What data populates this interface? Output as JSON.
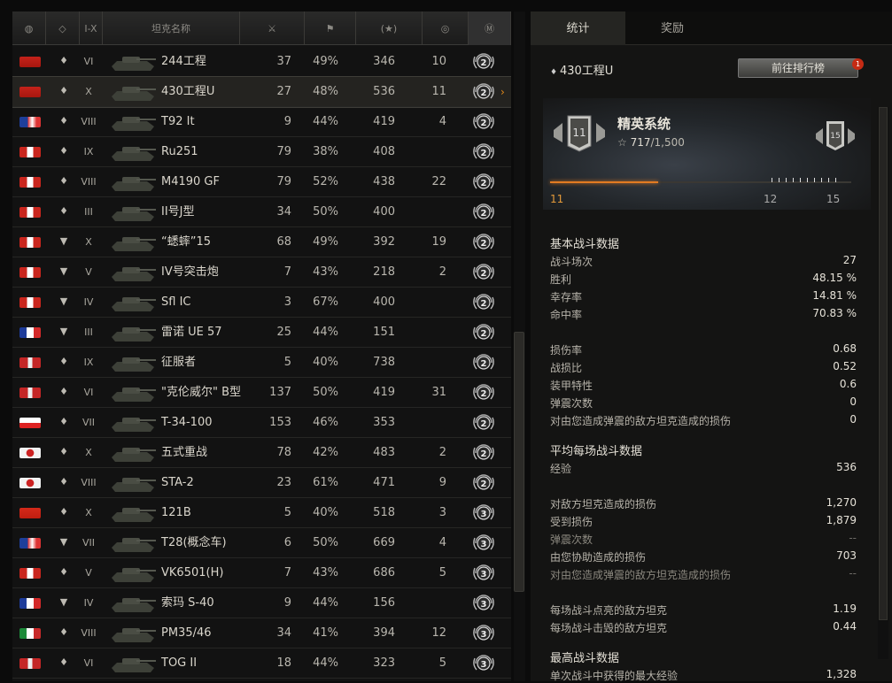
{
  "header": {
    "tier_label": "I-X",
    "name_label": "坦克名称"
  },
  "tanks": [
    {
      "nation": "ussr",
      "type": "heavy",
      "tier": "VI",
      "name": "244工程",
      "battles": "37",
      "win": "49%",
      "avg_xp": "346",
      "marks": "10",
      "mastery": "2"
    },
    {
      "nation": "ussr",
      "type": "heavy",
      "tier": "X",
      "name": "430工程U",
      "battles": "27",
      "win": "48%",
      "avg_xp": "536",
      "marks": "11",
      "mastery": "2",
      "selected": true
    },
    {
      "nation": "usa",
      "type": "heavy",
      "tier": "VIII",
      "name": "T92 It",
      "battles": "9",
      "win": "44%",
      "avg_xp": "419",
      "marks": "4",
      "mastery": "2"
    },
    {
      "nation": "germany",
      "type": "heavy",
      "tier": "IX",
      "name": "Ru251",
      "battles": "79",
      "win": "38%",
      "avg_xp": "408",
      "marks": "",
      "mastery": "2"
    },
    {
      "nation": "germany",
      "type": "heavy",
      "tier": "VIII",
      "name": "M4190 GF",
      "battles": "79",
      "win": "52%",
      "avg_xp": "438",
      "marks": "22",
      "mastery": "2"
    },
    {
      "nation": "germany",
      "type": "heavy",
      "tier": "III",
      "name": "II号J型",
      "battles": "34",
      "win": "50%",
      "avg_xp": "400",
      "marks": "",
      "mastery": "2"
    },
    {
      "nation": "germany",
      "type": "td",
      "tier": "X",
      "name": "“蟋蟀”15",
      "battles": "68",
      "win": "49%",
      "avg_xp": "392",
      "marks": "19",
      "mastery": "2"
    },
    {
      "nation": "germany",
      "type": "td",
      "tier": "V",
      "name": "IV号突击炮",
      "battles": "7",
      "win": "43%",
      "avg_xp": "218",
      "marks": "2",
      "mastery": "2"
    },
    {
      "nation": "germany",
      "type": "td",
      "tier": "IV",
      "name": "Sfl IC",
      "battles": "3",
      "win": "67%",
      "avg_xp": "400",
      "marks": "",
      "mastery": "2"
    },
    {
      "nation": "france",
      "type": "td",
      "tier": "III",
      "name": "雷诺 UE 57",
      "battles": "25",
      "win": "44%",
      "avg_xp": "151",
      "marks": "",
      "mastery": "2"
    },
    {
      "nation": "uk",
      "type": "heavy",
      "tier": "IX",
      "name": "征服者",
      "battles": "5",
      "win": "40%",
      "avg_xp": "738",
      "marks": "",
      "mastery": "2"
    },
    {
      "nation": "uk",
      "type": "heavy",
      "tier": "VI",
      "name": "\"克伦威尔\" B型",
      "battles": "137",
      "win": "50%",
      "avg_xp": "419",
      "marks": "31",
      "mastery": "2"
    },
    {
      "nation": "czech",
      "type": "heavy",
      "tier": "VII",
      "name": "T-34-100",
      "battles": "153",
      "win": "46%",
      "avg_xp": "353",
      "marks": "",
      "mastery": "2"
    },
    {
      "nation": "japan",
      "type": "heavy",
      "tier": "X",
      "name": "五式重战",
      "battles": "78",
      "win": "42%",
      "avg_xp": "483",
      "marks": "2",
      "mastery": "2"
    },
    {
      "nation": "japan",
      "type": "heavy",
      "tier": "VIII",
      "name": "STA-2",
      "battles": "23",
      "win": "61%",
      "avg_xp": "471",
      "marks": "9",
      "mastery": "2"
    },
    {
      "nation": "china",
      "type": "heavy",
      "tier": "X",
      "name": "121B",
      "battles": "5",
      "win": "40%",
      "avg_xp": "518",
      "marks": "3",
      "mastery": "3"
    },
    {
      "nation": "usa",
      "type": "td",
      "tier": "VII",
      "name": "T28(概念车)",
      "battles": "6",
      "win": "50%",
      "avg_xp": "669",
      "marks": "4",
      "mastery": "3"
    },
    {
      "nation": "germany",
      "type": "heavy",
      "tier": "V",
      "name": "VK6501(H)",
      "battles": "7",
      "win": "43%",
      "avg_xp": "686",
      "marks": "5",
      "mastery": "3"
    },
    {
      "nation": "france",
      "type": "td",
      "tier": "IV",
      "name": "索玛 S-40",
      "battles": "9",
      "win": "44%",
      "avg_xp": "156",
      "marks": "",
      "mastery": "3"
    },
    {
      "nation": "italy",
      "type": "heavy",
      "tier": "VIII",
      "name": "PM35/46",
      "battles": "34",
      "win": "41%",
      "avg_xp": "394",
      "marks": "12",
      "mastery": "3"
    },
    {
      "nation": "uk",
      "type": "heavy",
      "tier": "VI",
      "name": "TOG II",
      "battles": "18",
      "win": "44%",
      "avg_xp": "323",
      "marks": "5",
      "mastery": "3"
    }
  ],
  "tabs": {
    "stats": "统计",
    "awards": "奖励"
  },
  "detail": {
    "tank_name": "430工程U",
    "ranking_button": "前往排行榜",
    "ranking_badge": "1",
    "elite_title": "精英系统",
    "elite_level": "11",
    "elite_next_badge": "15",
    "elite_points": "717",
    "elite_points_max": "/1,500",
    "elite_progress": 0.36,
    "progress_labels": {
      "start": "11",
      "mid": "12",
      "end": "15"
    }
  },
  "sections": [
    {
      "title": "基本战斗数据",
      "rows": [
        {
          "label": "战斗场次",
          "value": "27"
        },
        {
          "label": "胜利",
          "value": "48.15 %"
        },
        {
          "label": "幸存率",
          "value": "14.81 %"
        },
        {
          "label": "命中率",
          "value": "70.83 %"
        },
        {
          "label": "损伤率",
          "value": "0.68"
        },
        {
          "label": "战损比",
          "value": "0.52"
        },
        {
          "label": "装甲特性",
          "value": "0.6"
        },
        {
          "label": "弹震次数",
          "value": "0"
        },
        {
          "label": "对由您造成弹震的敌方坦克造成的损伤",
          "value": "0"
        }
      ]
    },
    {
      "title": "平均每场战斗数据",
      "rows": [
        {
          "label": "经验",
          "value": "536"
        },
        {
          "label": "对敌方坦克造成的损伤",
          "value": "1,270"
        },
        {
          "label": "受到损伤",
          "value": "1,879"
        },
        {
          "label": "弹震次数",
          "value": "--"
        },
        {
          "label": "由您协助造成的损伤",
          "value": "703"
        },
        {
          "label": "对由您造成弹震的敌方坦克造成的损伤",
          "value": "--"
        },
        {
          "label": "每场战斗点亮的敌方坦克",
          "value": "1.19"
        },
        {
          "label": "每场战斗击毁的敌方坦克",
          "value": "0.44"
        }
      ]
    },
    {
      "title": "最高战斗数据",
      "rows": [
        {
          "label": "单次战斗中获得的最大经验",
          "value": "1,328"
        }
      ]
    }
  ],
  "colors": {
    "accent": "#e27b22",
    "badge": "#c52b14"
  }
}
